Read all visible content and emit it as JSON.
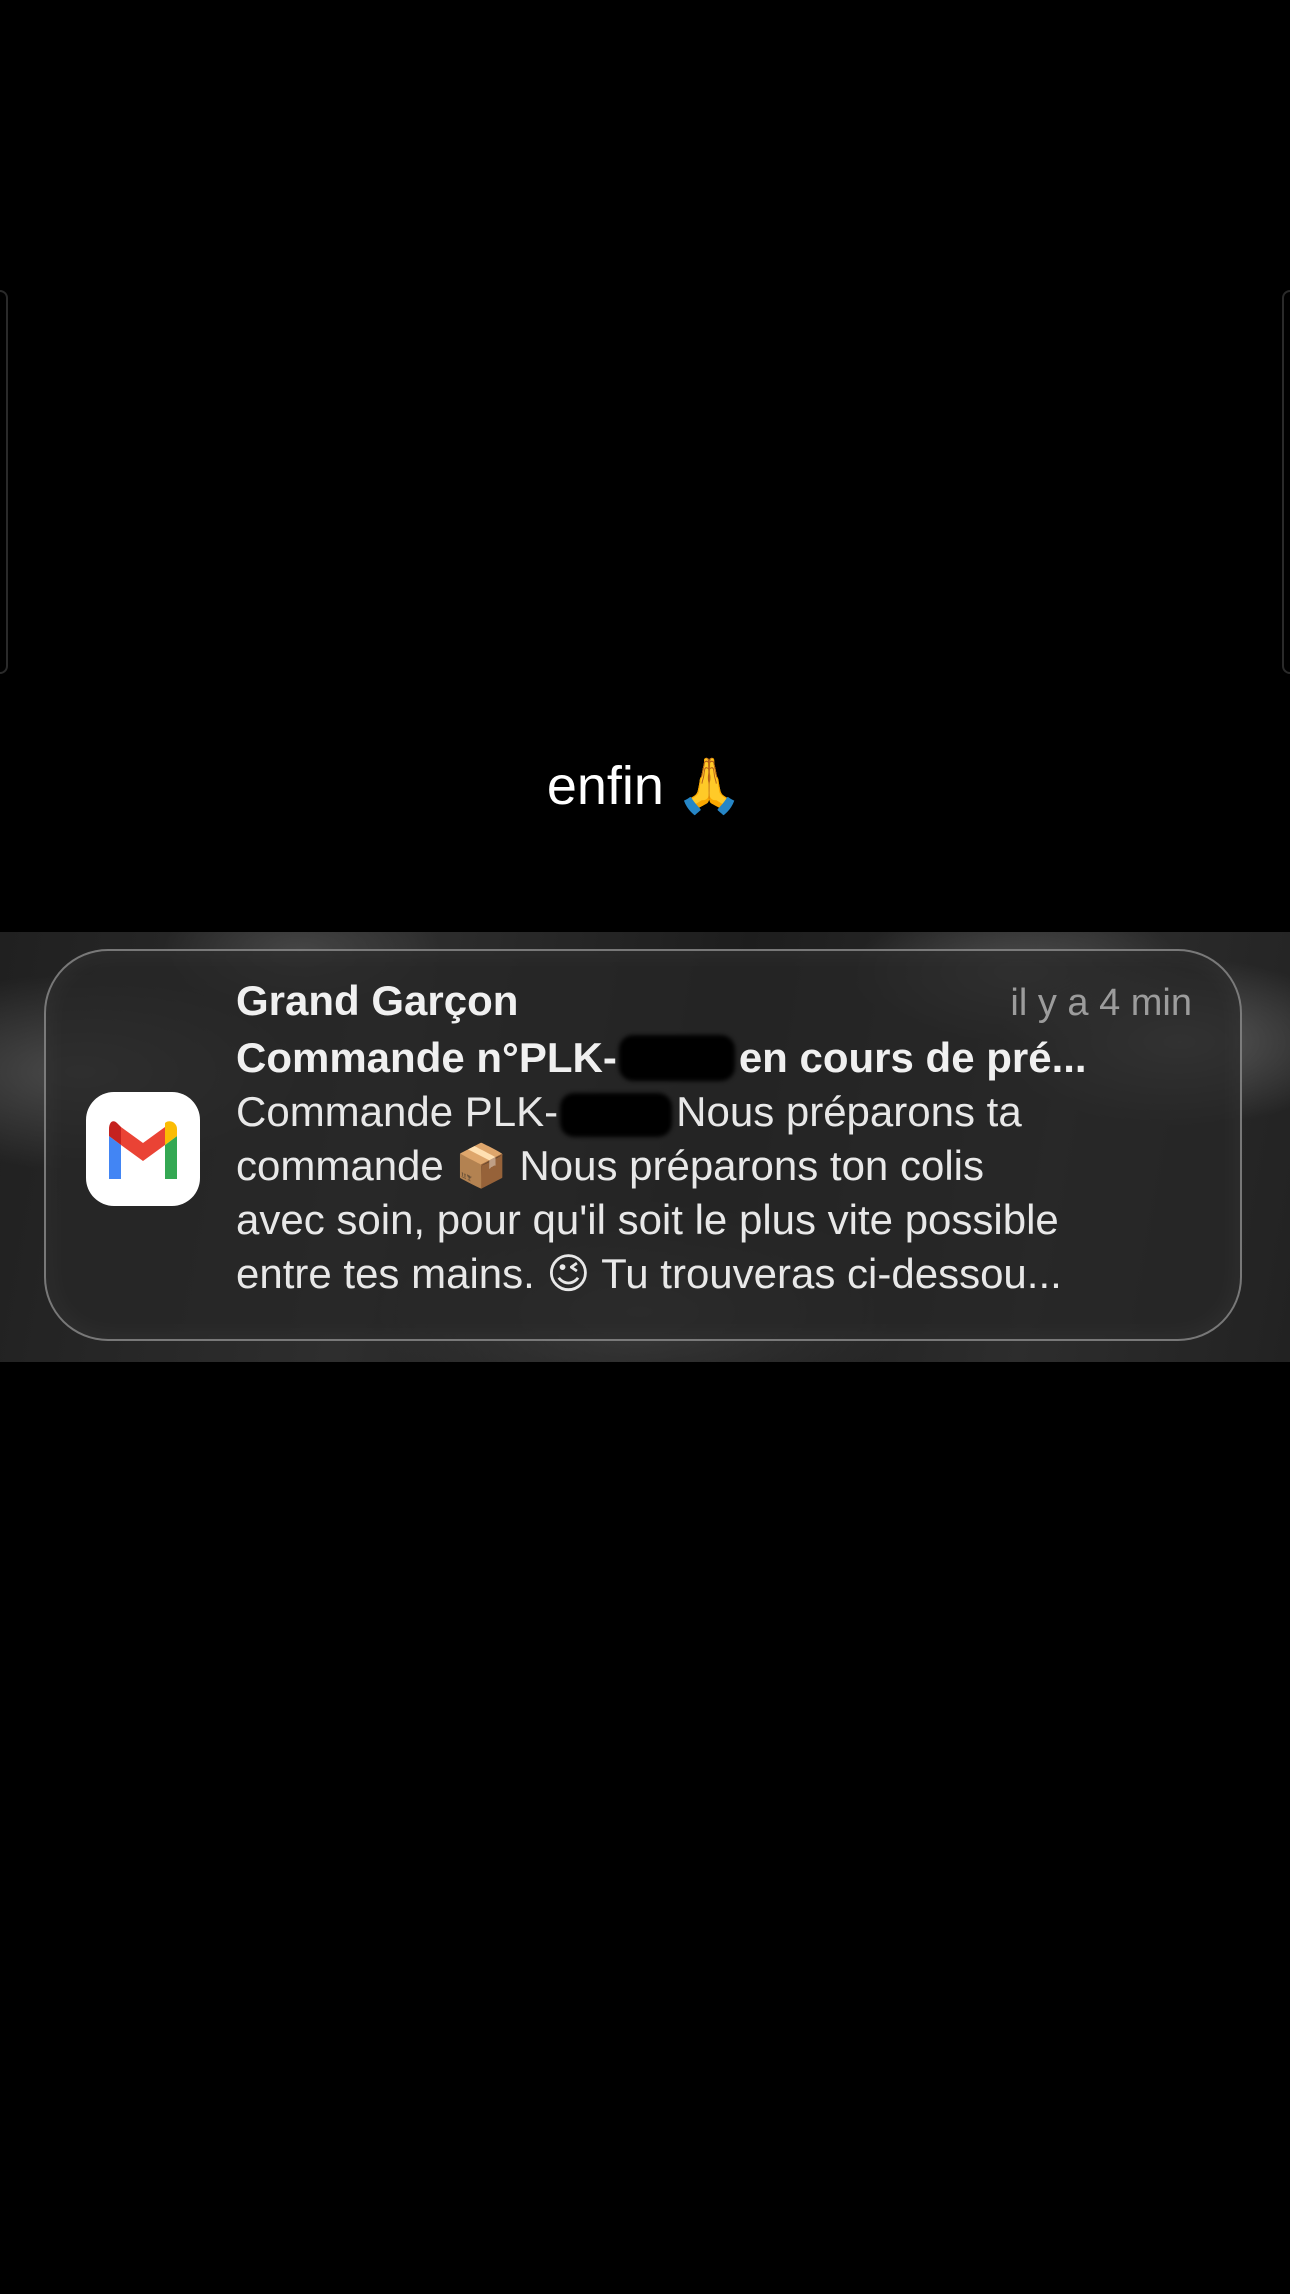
{
  "story": {
    "caption_text": "enfin",
    "caption_emoji": "🙏"
  },
  "notification": {
    "app_icon": "gmail-icon",
    "sender": "Grand Garçon",
    "time": "il y a 4 min",
    "subject_prefix": "Commande n°PLK-",
    "subject_suffix": "en cours de pré...",
    "body_line1_prefix": "Commande PLK-",
    "body_line1_suffix": "Nous préparons ta",
    "body_line2": "commande 📦 Nous préparons ton colis",
    "body_line3": "avec soin, pour qu'il soit le plus vite possible",
    "body_line4": "entre tes mains. 😉 Tu trouveras ci-dessou..."
  }
}
